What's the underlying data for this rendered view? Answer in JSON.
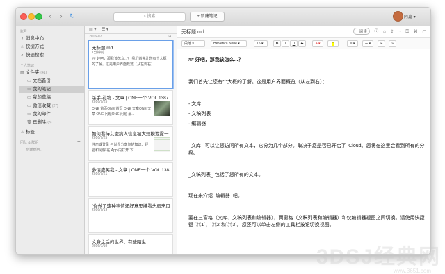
{
  "toolbar": {
    "search_placeholder": "搜索",
    "new_note_label": "+  新建笔记",
    "username": "阿嘉 ▾"
  },
  "sidebar": {
    "section_title": "账号",
    "top_items": [
      {
        "label": "消息中心",
        "icon": "bell-icon"
      },
      {
        "label": "快捷方式",
        "icon": "star-icon"
      },
      {
        "label": "快速搜索",
        "icon": "search-icon"
      }
    ],
    "notes_section": "个人笔记",
    "folder_root": {
      "label": "文件夹",
      "count": "(41)"
    },
    "folders": [
      {
        "label": "文档备份",
        "count": ""
      },
      {
        "label": "我的笔记",
        "count": ""
      },
      {
        "label": "我的草稿",
        "count": ""
      },
      {
        "label": "微信收藏",
        "count": "(27)"
      },
      {
        "label": "我的邮件",
        "count": ""
      },
      {
        "label": "已删除",
        "count": "(3)"
      }
    ],
    "tags_label": "标签",
    "team_section": "团队 & 群组",
    "create_team": "创建群组..."
  },
  "notelist": {
    "date_group": "2016-07",
    "count": "14",
    "notes": [
      {
        "title": "无标题.md",
        "date": "1分钟前",
        "snippet": "## 好吧，那我该怎么...？ 我们首先让您有个大概的了解。这是用户界面概览（从左到右）"
      },
      {
        "title": "杀手-礼物 - 文章 | ONE一个 VOL.1387",
        "date": "2016/7/25",
        "snippet": "ONE 首页ONE 首页 ONE 文章ONE 文章 ONE 问题ONE 问题 最..."
      },
      {
        "title": "如何看待艾滋病人信息被大规模泄露一...",
        "date": "2016/7/25",
        "snippet": "注册或登录 与世界分享你的知识、经验和见解 在 App 内打开 下..."
      },
      {
        "title": "多情应笑我 - 文章 | ONE一个 VOL.1383",
        "date": "2016/7/21",
        "snippet": ""
      },
      {
        "title": "\"你做了这种事情还好意思嫌看头皮来见...",
        "date": "2016/7/19",
        "snippet": ""
      },
      {
        "title": "文身之后的世界，有些陌生",
        "date": "2016/7/19",
        "snippet": ""
      }
    ]
  },
  "editor": {
    "title": "无标题.md",
    "preview_label": "阅读",
    "format": {
      "paragraph": "段落",
      "font": "Helvetica Neue",
      "size": "15",
      "bold": "B",
      "italic": "I",
      "underline": "U",
      "strike": "S",
      "color": "A"
    },
    "paragraphs": [
      "## 好吧，那我该怎么...？",
      "我们首先让您有个大概的了解。这是用户界面概览（从左到右）：",
      "- 文库",
      "- 文稿列表",
      "- 编辑器",
      "_文库_ 可以让您访问所有文本，它分为几个部分。取决于您是否已开启了 iCloud。您将在这里会看到所有的分段。",
      "_文稿列表_ 包括了您所有的文本。",
      "现在来介绍_编辑器_吧。",
      "要在三窗格（文库、文稿列表和编辑器），两窗格（文稿列表和编辑器）和仅编辑器视图之间切换，请使用快捷键 `⌘1`，`⌘2`和`⌘3`。您还可以单击左侧的工具栏按钮切换视图。"
    ]
  },
  "watermark": {
    "big": "3DSJ经典网",
    "small": "www.3651.com"
  }
}
